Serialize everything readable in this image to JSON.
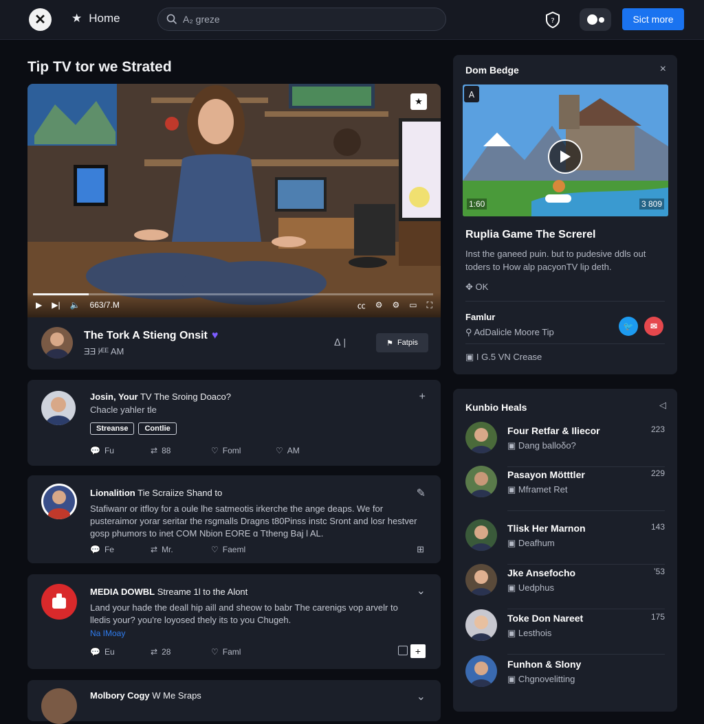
{
  "topbar": {
    "logo_glyph": "✕",
    "home_label": "Home",
    "search_placeholder": "A₂ greze",
    "cta_label": "Sict more"
  },
  "page": {
    "title": "Tip TV tor we Strated"
  },
  "player": {
    "time": "663/7.M",
    "progress": 0.14
  },
  "video": {
    "title": "The Tork A Stieng Onsit",
    "subtitle": "ƎƎ ᴵ⁄ᴱᴱ AM",
    "like_label": "ᐃ |",
    "follow_label": "Fatpis"
  },
  "posts": [
    {
      "author": "Josin, Your",
      "title": "TV The Sroing Doaco?",
      "text": "Chacle yahler tle",
      "tags": [
        "Streanse",
        "Contlie"
      ],
      "actions": [
        "Fu",
        "88",
        "Foml",
        "AM"
      ]
    },
    {
      "author": "Lionalition",
      "title": "Tie Scraiize Shand to",
      "text": "Stafiwanr or itfloy for a oule lhe satmeotis irkerche the ange deaps. We for pusteraimor yorar seritar the rsgmalls Dragns t80Pinss instc Sront and losr hestver gosp phumors to inet COM Nbion EORE ɑ Ttheng Baj l AL.",
      "actions": [
        "Fe",
        "Mr.",
        "Faeml"
      ]
    },
    {
      "author": "MEDIA DOWBL",
      "title": "Streame 1l to the Alont",
      "text": "Land your hade the deall hip aill and sheow to babr The carenigs vop arvelr to lledis your? you're loyosed thely its to you Chugeh.",
      "link": "Na IMoay",
      "actions": [
        "Eu",
        "28",
        "Faml"
      ]
    },
    {
      "author": "Molbory Cogy",
      "title": "W Me Sraps"
    }
  ],
  "featured": {
    "panel_title": "Dom Bedge",
    "duration": "1:60",
    "views": "3 809",
    "game_title": "Ruplia Game The Screrel",
    "description": "Inst the ganeed puin. but to pudesive ddls out toders to How alp pacyonTV lip deth.",
    "ok_label": "OK",
    "family_label": "Famlur",
    "family_sub": "AdDalicle Moore Tip",
    "family_sub2": "I G.5 VN Crease",
    "social": [
      "twitter",
      "mail"
    ]
  },
  "friends": {
    "title": "Kunbio Heals",
    "items": [
      {
        "name": "Four Retfar & Iliecor",
        "sub": "Dang balloδο?",
        "count": "223"
      },
      {
        "name": "Pasayon Mötttler",
        "sub": "Mframet Ret",
        "count": "229"
      },
      {
        "name": "Tlisk Her Marnon",
        "sub": "Deafhum",
        "count": "143"
      },
      {
        "name": "Jke Ansefocho",
        "sub": "Uedphus",
        "count": "ʼ53"
      },
      {
        "name": "Toke Don Nareet",
        "sub": "Lesthois",
        "count": "175"
      },
      {
        "name": "Funhon & Slony",
        "sub": "Chgnovelitting",
        "count": ""
      }
    ]
  },
  "colors": {
    "accent": "#1a73f0",
    "heart": "#7c5cff",
    "twitter": "#1d9bf0",
    "mail": "#e5484d",
    "media_avatar": "#d9292b"
  }
}
